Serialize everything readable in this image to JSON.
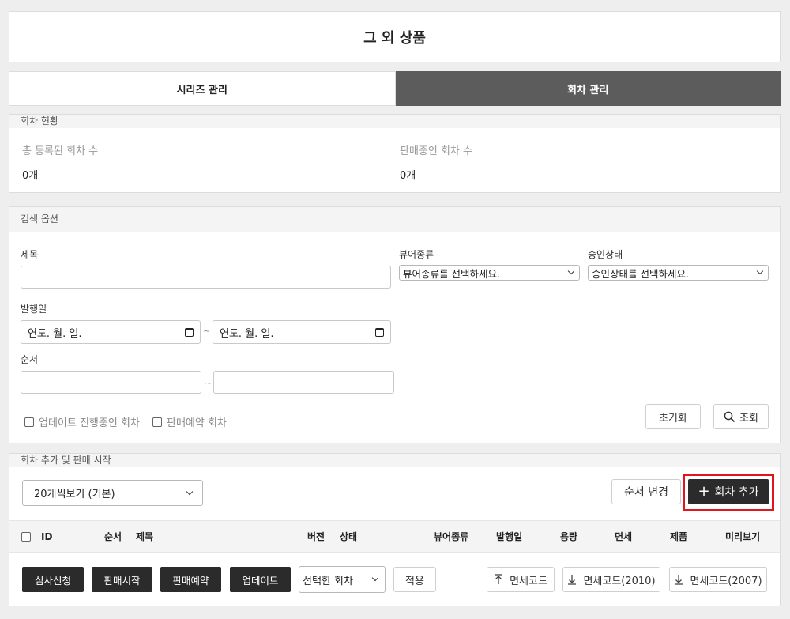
{
  "page": {
    "title": "그 외 상품"
  },
  "tabs": [
    {
      "label": "시리즈 관리",
      "active": false
    },
    {
      "label": "회차 관리",
      "active": true
    }
  ],
  "status": {
    "header": "회차 현황",
    "total_label": "총 등록된 회차 수",
    "total_value": "0개",
    "selling_label": "판매중인 회차 수",
    "selling_value": "0개"
  },
  "search": {
    "header": "검색 옵션",
    "title_label": "제목",
    "title_value": "",
    "viewer_label": "뷰어종류",
    "viewer_selected": "뷰어종류를 선택하세요.",
    "approval_label": "승인상태",
    "approval_selected": "승인상태를 선택하세요.",
    "date_label": "발행일",
    "date_from": "연도. 월. 일.",
    "date_to": "연도. 월. 일.",
    "order_label": "순서",
    "order_from": "",
    "order_to": "",
    "tilde": "~",
    "check_updating": "업데이트 진행중인 회차",
    "check_reserved": "판매예약 회차",
    "reset_label": "초기화",
    "search_label": "조회"
  },
  "episodes": {
    "header": "회차 추가 및 판매 시작",
    "page_size_selected": "20개씩보기 (기본)",
    "reorder_label": "순서 변경",
    "add_label": "회차 추가",
    "columns": [
      "ID",
      "순서",
      "제목",
      "버전",
      "상태",
      "뷰어종류",
      "발행일",
      "용량",
      "면세",
      "제품",
      "미리보기"
    ],
    "actions": {
      "review": "심사신청",
      "start_sale": "판매시작",
      "reserve_sale": "판매예약",
      "update": "업데이트",
      "selected_option": "선택한 회차",
      "apply": "적용",
      "tax_code": "면세코드",
      "tax_code_2010": "면세코드(2010)",
      "tax_code_2007": "면세코드(2007)"
    }
  },
  "colors": {
    "highlight": "#e0161c",
    "dark_button": "#2b2b2b",
    "active_tab": "#5c5c5c"
  }
}
